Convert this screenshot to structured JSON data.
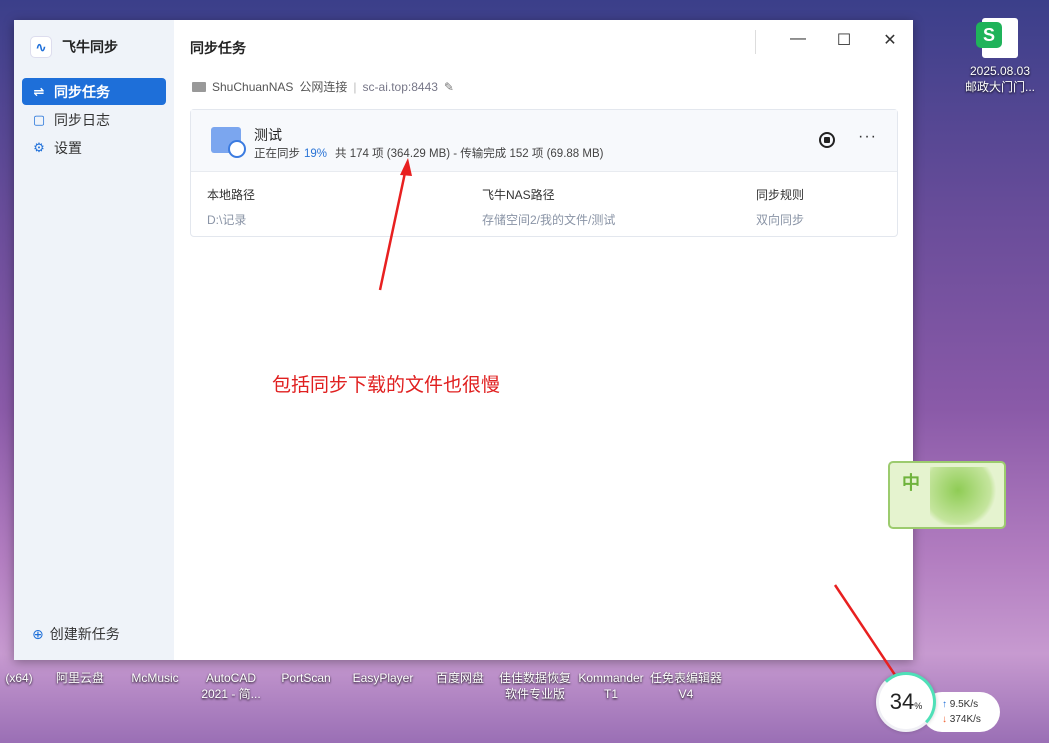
{
  "app": {
    "name": "飞牛同步"
  },
  "sidebar": {
    "items": [
      {
        "label": "同步任务",
        "icon": "sync-icon",
        "active": true
      },
      {
        "label": "同步日志",
        "icon": "log-icon"
      },
      {
        "label": "设置",
        "icon": "gear-icon"
      }
    ],
    "new_task": "创建新任务"
  },
  "header": {
    "title": "同步任务"
  },
  "connection": {
    "device": "ShuChuanNAS",
    "mode": "公网连接",
    "host": "sc-ai.top:8443"
  },
  "task": {
    "name": "测试",
    "status": "正在同步",
    "percent": "19%",
    "summary": "共 174 项 (364.29 MB) - 传输完成 152 项 (69.88 MB)",
    "columns": [
      {
        "label": "本地路径",
        "value": "D:\\记录"
      },
      {
        "label": "飞牛NAS路径",
        "value": "存储空间2/我的文件/测试"
      },
      {
        "label": "同步规则",
        "value": "双向同步"
      }
    ]
  },
  "annotation": "包括同步下载的文件也很慢",
  "desktop": {
    "file_icon": {
      "line1": "2025.08.03",
      "line2": "邮政大门门..."
    },
    "taskbar": [
      "(x64)",
      "阿里云盘",
      "McMusic",
      "AutoCAD 2021 - 简...",
      "PortScan",
      "EasyPlayer",
      "百度网盘",
      "佳佳数据恢复软件专业版",
      "Kommander T1",
      "任免表编辑器 V4"
    ]
  },
  "ime": {
    "label": "中"
  },
  "netmon": {
    "percent": "34",
    "unit": "%",
    "up": "9.5K/s",
    "down": "374K/s"
  },
  "colors": {
    "accent": "#1e6fd9",
    "annotation": "#e02020"
  }
}
